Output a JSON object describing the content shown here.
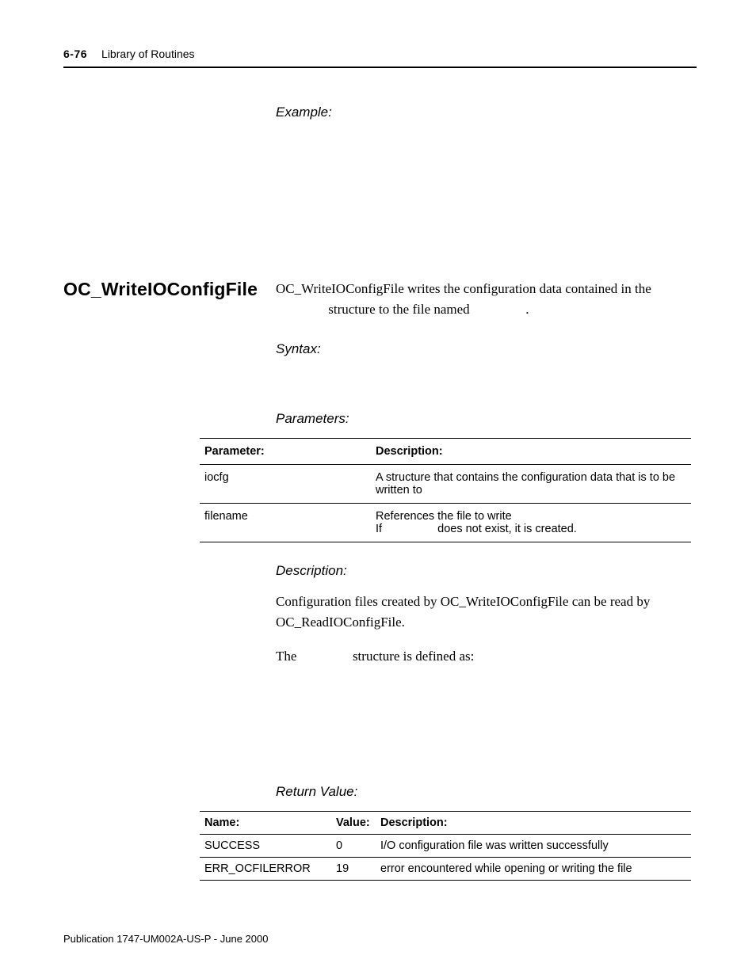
{
  "header": {
    "page_number": "6-76",
    "section_title": "Library of Routines"
  },
  "example_label": "Example:",
  "section": {
    "title": "OC_WriteIOConfigFile",
    "intro_part1": "OC_WriteIOConfigFile writes the configuration data contained in the ",
    "intro_part2": " structure to the file named ",
    "intro_part3": "."
  },
  "syntax_label": "Syntax:",
  "parameters_label": "Parameters:",
  "param_table": {
    "head_param": "Parameter:",
    "head_desc": "Description:",
    "rows": [
      {
        "param": "iocfg",
        "desc_a": "A structure that contains the configuration data that is to be written to "
      },
      {
        "param": "filename",
        "desc_a": "References the file to write",
        "desc_b": "If ",
        "desc_c": " does not exist, it is created."
      }
    ]
  },
  "description_label": "Description:",
  "description_para": "Configuration files created by OC_WriteIOConfigFile can be read by OC_ReadIOConfigFile.",
  "struct_line_a": "The ",
  "struct_line_b": " structure is defined as:",
  "return_label": "Return Value:",
  "rv_table": {
    "head_name": "Name:",
    "head_value": "Value:",
    "head_desc": "Description:",
    "rows": [
      {
        "name": "SUCCESS",
        "value": "0",
        "desc": "I/O configuration file was written successfully"
      },
      {
        "name": "ERR_OCFILERROR",
        "value": "19",
        "desc": "error encountered while opening or writing the file"
      }
    ]
  },
  "footer": "Publication 1747-UM002A-US-P - June 2000"
}
